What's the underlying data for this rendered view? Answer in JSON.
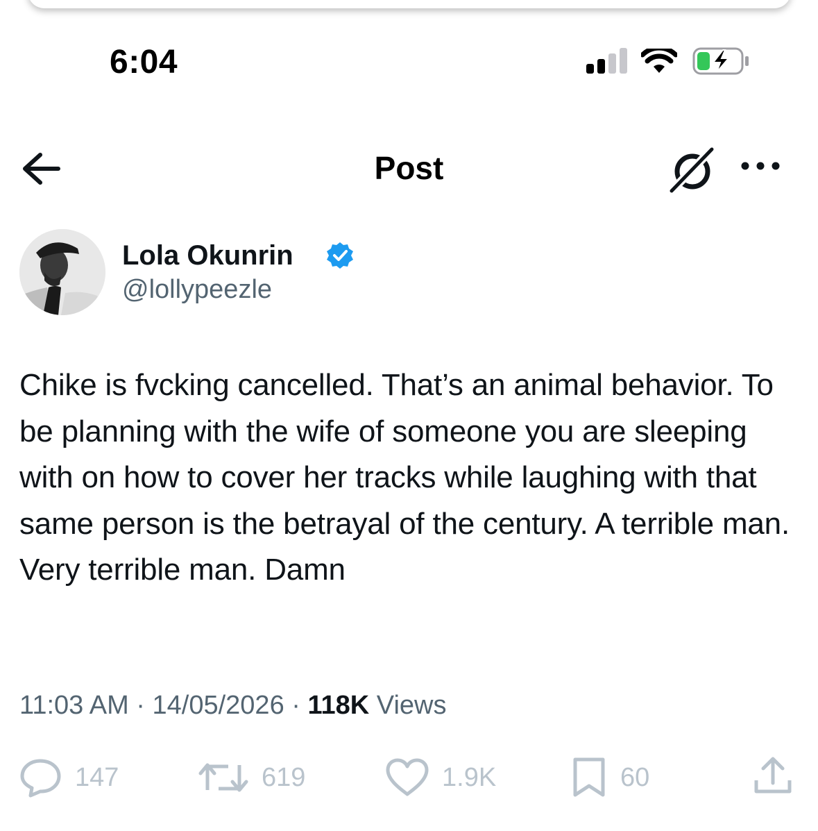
{
  "status_bar": {
    "time": "6:04",
    "icons": [
      "cellular-signal-icon",
      "wifi-icon",
      "battery-charging-icon"
    ],
    "battery_color": "#34c759"
  },
  "header": {
    "title": "Post",
    "back_icon": "arrow-left-icon",
    "grok_icon": "grok-icon",
    "more_icon": "more-horizontal-icon"
  },
  "tweet": {
    "author": {
      "name": "Lola Okunrin",
      "handle": "@lollypeezle",
      "verified": true,
      "verified_color": "#1d9bf0"
    },
    "text": "Chike is fvcking cancelled. That’s an animal behavior. To be planning with the wife of someone you are sleeping with on how to cover her tracks while laughing with that same person is the betrayal of the century. A terrible man. Very terrible man. Damn",
    "time": "11:03 AM",
    "date": "14/05/2026",
    "views_count": "118K",
    "views_label": "Views",
    "separator": "·"
  },
  "actions": {
    "replies": "147",
    "reposts": "619",
    "likes": "1.9K",
    "bookmarks": "60",
    "icons": [
      "reply-icon",
      "repost-icon",
      "like-icon",
      "bookmark-icon",
      "share-icon"
    ],
    "muted_color": "#b9c3cc"
  }
}
